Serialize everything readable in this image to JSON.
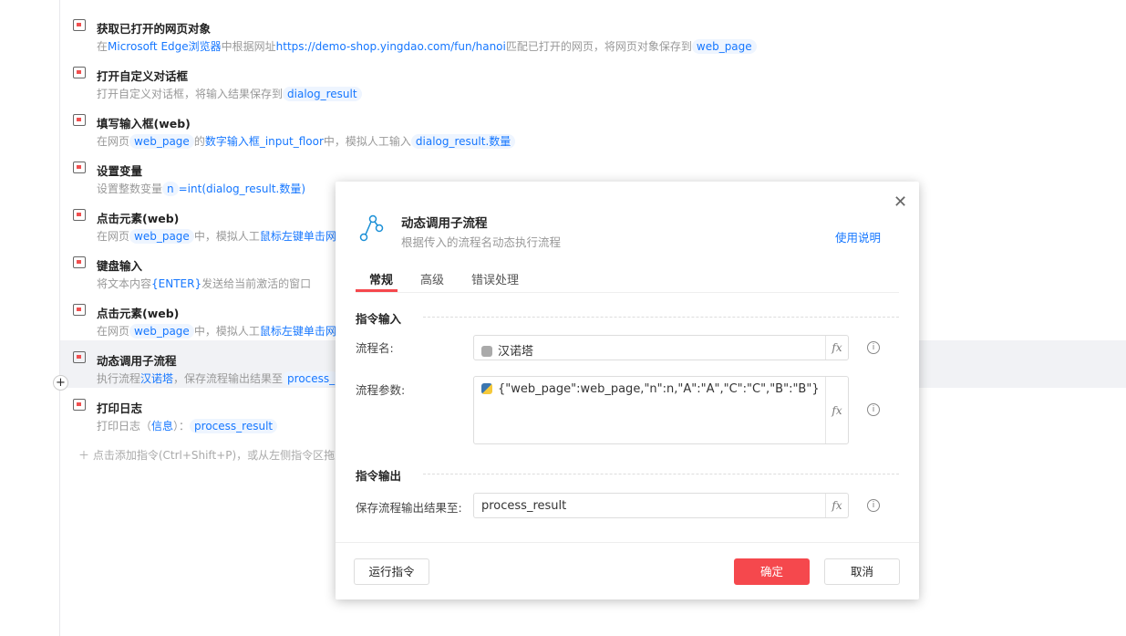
{
  "steps": [
    {
      "title": "获取已打开的网页对象",
      "desc": [
        [
          "在",
          ""
        ],
        [
          "Microsoft Edge浏览器",
          "b"
        ],
        [
          "中根据网址",
          ""
        ],
        [
          "https://demo-shop.yingdao.com/fun/hanoi",
          "b"
        ],
        [
          "匹配已打开的网页，将网页对象保存到",
          ""
        ],
        [
          "web_page",
          "chip"
        ]
      ]
    },
    {
      "title": "打开自定义对话框",
      "desc": [
        [
          "打开自定义对话框，将输入结果保存到",
          ""
        ],
        [
          "dialog_result",
          "chip"
        ]
      ]
    },
    {
      "title": "填写输入框(web)",
      "desc": [
        [
          "在网页",
          ""
        ],
        [
          "web_page",
          "chip"
        ],
        [
          "的",
          ""
        ],
        [
          "数字输入框_input_floor",
          "b"
        ],
        [
          "中，模拟人工输入",
          ""
        ],
        [
          "dialog_result.数量",
          "chip"
        ]
      ]
    },
    {
      "title": "设置变量",
      "desc": [
        [
          "设置整数变量",
          ""
        ],
        [
          "n",
          "chip"
        ],
        [
          "=int(dialog_result.数量)",
          "b"
        ]
      ]
    },
    {
      "title": "点击元素(web)",
      "desc": [
        [
          "在网页",
          ""
        ],
        [
          "web_page",
          "chip"
        ],
        [
          "中，模拟人工",
          ""
        ],
        [
          "鼠标左键单击网",
          "b"
        ]
      ]
    },
    {
      "title": "键盘输入",
      "desc": [
        [
          "将文本内容",
          ""
        ],
        [
          "{ENTER}",
          "b"
        ],
        [
          "发送给当前激活的窗口",
          ""
        ]
      ]
    },
    {
      "title": "点击元素(web)",
      "desc": [
        [
          "在网页",
          ""
        ],
        [
          "web_page",
          "chip"
        ],
        [
          "中，模拟人工",
          ""
        ],
        [
          "鼠标左键单击网",
          "b"
        ]
      ]
    },
    {
      "title": "动态调用子流程",
      "desc": [
        [
          "执行流程",
          ""
        ],
        [
          "汉诺塔",
          "b"
        ],
        [
          "，保存流程输出结果至",
          ""
        ],
        [
          "process_",
          "chip"
        ]
      ]
    },
    {
      "title": "打印日志",
      "desc": [
        [
          "打印日志（",
          ""
        ],
        [
          "信息",
          "b"
        ],
        [
          "）：",
          ""
        ],
        [
          "process_result",
          "chip"
        ]
      ]
    }
  ],
  "add_hint": "点击添加指令(Ctrl+Shift+P)，或从左侧指令区拖入",
  "dialog": {
    "title": "动态调用子流程",
    "subtitle": "根据传入的流程名动态执行流程",
    "help": "使用说明",
    "tabs": [
      "常规",
      "高级",
      "错误处理"
    ],
    "section_input": "指令输入",
    "section_output": "指令输出",
    "name_label": "流程名:",
    "name_value": "汉诺塔",
    "params_label": "流程参数:",
    "params_value": "{\"web_page\":web_page,\"n\":n,\"A\":\"A\",\"C\":\"C\",\"B\":\"B\"}",
    "output_label": "保存流程输出结果至:",
    "output_value": "process_result",
    "fx": "fx",
    "info": "i",
    "close": "✕",
    "run": "运行指令",
    "ok": "确定",
    "cancel": "取消"
  }
}
